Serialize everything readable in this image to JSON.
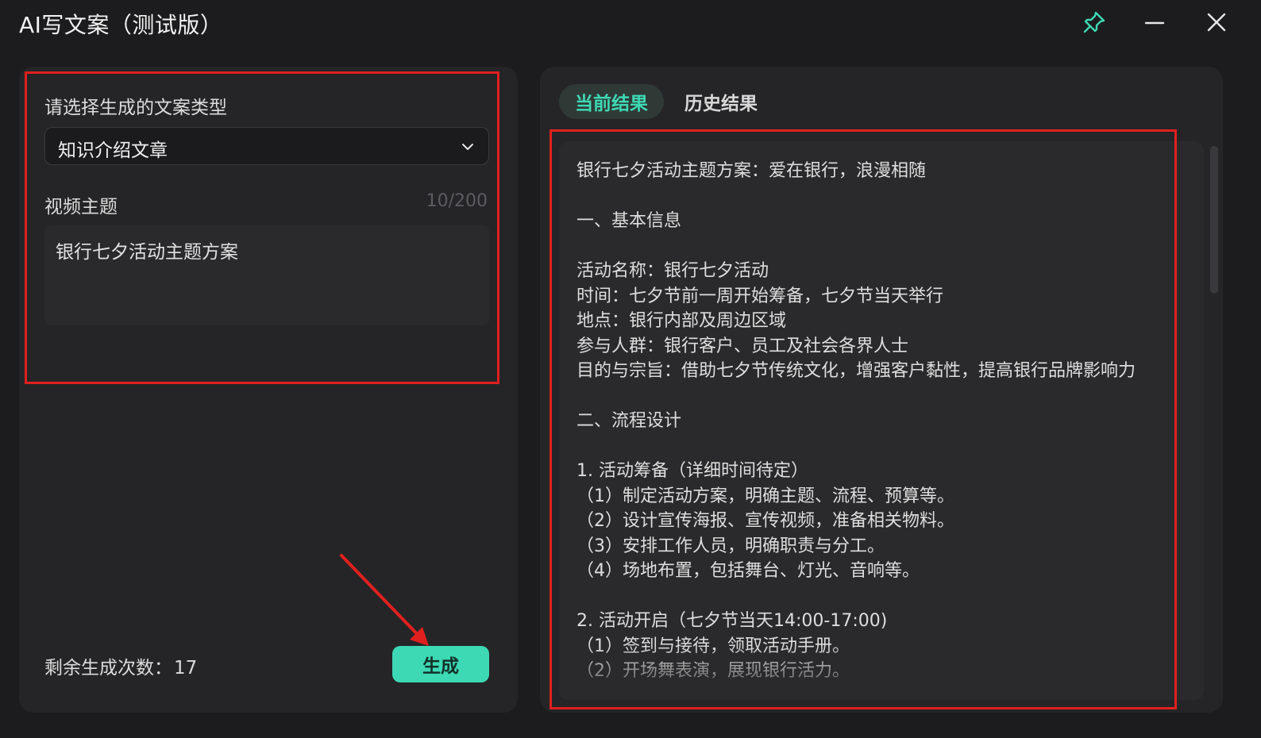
{
  "window": {
    "title": "AI写文案（测试版）",
    "pin_icon": "pin-icon",
    "minimize_icon": "minimize-icon",
    "close_icon": "close-icon",
    "accent_color": "#3dd9b4"
  },
  "left": {
    "type_label": "请选择生成的文案类型",
    "type_value": "知识介绍文章",
    "topic_label": "视频主题",
    "topic_counter": "10/200",
    "topic_value": "银行七夕活动主题方案",
    "remaining_label": "剩余生成次数：",
    "remaining_count": "17",
    "generate_label": "生成"
  },
  "right": {
    "tabs": [
      {
        "label": "当前结果",
        "active": true
      },
      {
        "label": "历史结果",
        "active": false
      }
    ],
    "result_lines": [
      "银行七夕活动主题方案：爱在银行，浪漫相随",
      "",
      "一、基本信息",
      "",
      "活动名称：银行七夕活动",
      "时间：七夕节前一周开始筹备，七夕节当天举行",
      "地点：银行内部及周边区域",
      "参与人群：银行客户、员工及社会各界人士",
      "目的与宗旨：借助七夕节传统文化，增强客户黏性，提高银行品牌影响力",
      "",
      "二、流程设计",
      "",
      "1. 活动筹备（详细时间待定）",
      "（1）制定活动方案，明确主题、流程、预算等。",
      "（2）设计宣传海报、宣传视频，准备相关物料。",
      "（3）安排工作人员，明确职责与分工。",
      "（4）场地布置，包括舞台、灯光、音响等。",
      "",
      "2. 活动开启（七夕节当天14:00-17:00)",
      "（1）签到与接待，领取活动手册。",
      "（2）开场舞表演，展现银行活力。"
    ]
  }
}
